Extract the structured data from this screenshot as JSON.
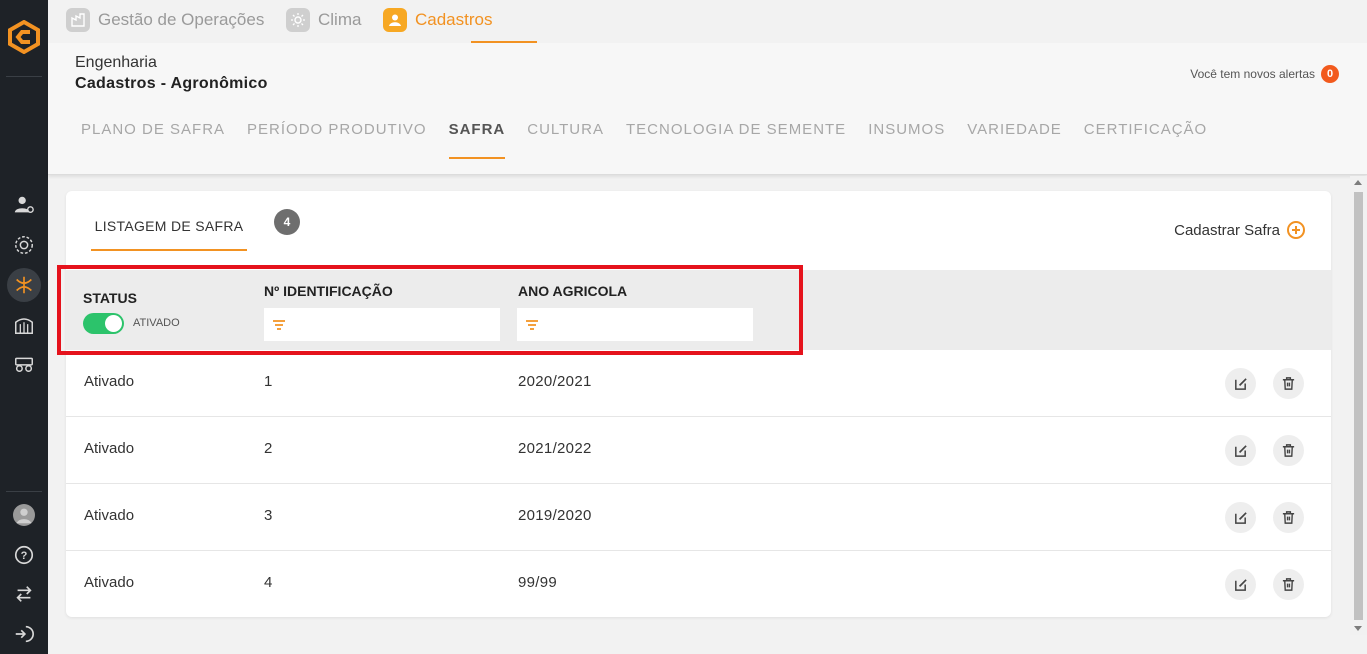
{
  "topnav": {
    "items": [
      {
        "label": "Gestão de Operações",
        "icon": "factory-icon"
      },
      {
        "label": "Clima",
        "icon": "sun-icon"
      },
      {
        "label": "Cadastros",
        "icon": "user-icon",
        "active": true
      }
    ]
  },
  "header": {
    "breadcrumb_parent": "Engenharia",
    "breadcrumb_current": "Cadastros - Agronômico",
    "alerts_text": "Você tem novos alertas",
    "alerts_count": "0"
  },
  "subtabs": [
    {
      "label": "PLANO DE SAFRA"
    },
    {
      "label": "PERÍODO PRODUTIVO"
    },
    {
      "label": "SAFRA",
      "active": true
    },
    {
      "label": "CULTURA"
    },
    {
      "label": "TECNOLOGIA DE SEMENTE"
    },
    {
      "label": "INSUMOS"
    },
    {
      "label": "VARIEDADE"
    },
    {
      "label": "CERTIFICAÇÃO"
    }
  ],
  "card": {
    "tab_label": "LISTAGEM DE SAFRA",
    "count": "4",
    "add_label": "Cadastrar Safra"
  },
  "filters": {
    "status_title": "STATUS",
    "status_toggle_label": "ATIVADO",
    "status_toggle_on": true,
    "id_title": "Nº IDENTIFICAÇÃO",
    "year_title": "ANO AGRICOLA"
  },
  "rows": [
    {
      "status": "Ativado",
      "id": "1",
      "year": "2020/2021"
    },
    {
      "status": "Ativado",
      "id": "2",
      "year": "2021/2022"
    },
    {
      "status": "Ativado",
      "id": "3",
      "year": "2019/2020"
    },
    {
      "status": "Ativado",
      "id": "4",
      "year": "99/99"
    }
  ],
  "colors": {
    "accent": "#f29222",
    "sidebar": "#1e2227",
    "toggle_on": "#2cc36b",
    "alert_badge": "#f25a1d",
    "highlight": "#e5121c"
  }
}
